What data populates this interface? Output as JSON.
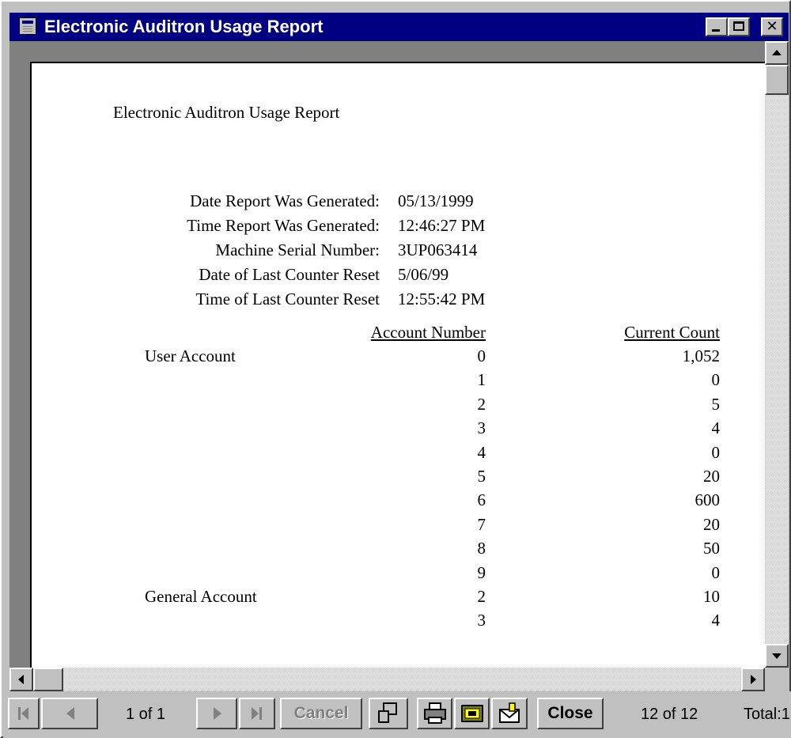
{
  "window": {
    "title": "Electronic Auditron Usage Report",
    "icon": "report-window-icon"
  },
  "titlebar_buttons": {
    "minimize": "minimize-icon",
    "maximize": "maximize-icon",
    "close": "✕"
  },
  "report": {
    "heading": "Electronic Auditron Usage Report",
    "meta": [
      {
        "label": "Date Report Was Generated:",
        "value": "05/13/1999"
      },
      {
        "label": "Time Report Was Generated:",
        "value": "12:46:27 PM"
      },
      {
        "label": "Machine Serial Number:",
        "value": "3UP063414"
      },
      {
        "label": "Date of Last Counter Reset",
        "value": "5/06/99"
      },
      {
        "label": "Time of Last Counter Reset",
        "value": "12:55:42 PM"
      }
    ],
    "columns": {
      "account_number": "Account Number",
      "current_count": "Current Count"
    },
    "rows": [
      {
        "group": "User Account",
        "account": "0",
        "count": "1,052"
      },
      {
        "group": "",
        "account": "1",
        "count": "0"
      },
      {
        "group": "",
        "account": "2",
        "count": "5"
      },
      {
        "group": "",
        "account": "3",
        "count": "4"
      },
      {
        "group": "",
        "account": "4",
        "count": "0"
      },
      {
        "group": "",
        "account": "5",
        "count": "20"
      },
      {
        "group": "",
        "account": "6",
        "count": "600"
      },
      {
        "group": "",
        "account": "7",
        "count": "20"
      },
      {
        "group": "",
        "account": "8",
        "count": "50"
      },
      {
        "group": "",
        "account": "9",
        "count": "0"
      },
      {
        "group": "General Account",
        "account": "2",
        "count": "10"
      },
      {
        "group": "",
        "account": "3",
        "count": "4"
      }
    ]
  },
  "toolbar": {
    "page_indicator": "1 of 1",
    "cancel_label": "Cancel",
    "close_label": "Close",
    "records_indicator": "12 of 12",
    "total_label": "Total:1",
    "icons": [
      "first-page-icon",
      "previous-page-icon",
      "next-page-icon",
      "last-page-icon",
      "zoom-icon",
      "print-icon",
      "export-icon",
      "mail-icon"
    ]
  }
}
